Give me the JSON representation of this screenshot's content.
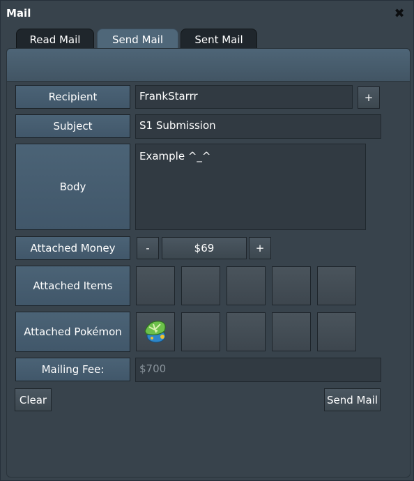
{
  "window": {
    "title": "Mail"
  },
  "tabs": [
    {
      "label": "Read Mail",
      "active": false
    },
    {
      "label": "Send Mail",
      "active": true
    },
    {
      "label": "Sent Mail",
      "active": false
    }
  ],
  "form": {
    "recipient_label": "Recipient",
    "recipient_value": "FrankStarrr",
    "recipient_add": "+",
    "subject_label": "Subject",
    "subject_value": "S1 Submission",
    "body_label": "Body",
    "body_value": "Example ^_^",
    "money_label": "Attached Money",
    "money_minus": "-",
    "money_value": "$69",
    "money_plus": "+",
    "items_label": "Attached Items",
    "pokemon_label": "Attached Pokémon",
    "fee_label": "Mailing Fee:",
    "fee_value": "$700"
  },
  "item_slots": [
    "empty",
    "empty",
    "empty",
    "empty",
    "empty"
  ],
  "pokemon_slots": [
    "pokemon-icon",
    "empty",
    "empty",
    "empty",
    "empty"
  ],
  "buttons": {
    "clear": "Clear",
    "send": "Send Mail"
  },
  "colors": {
    "accent": "#4b6376",
    "background": "#38434c"
  }
}
